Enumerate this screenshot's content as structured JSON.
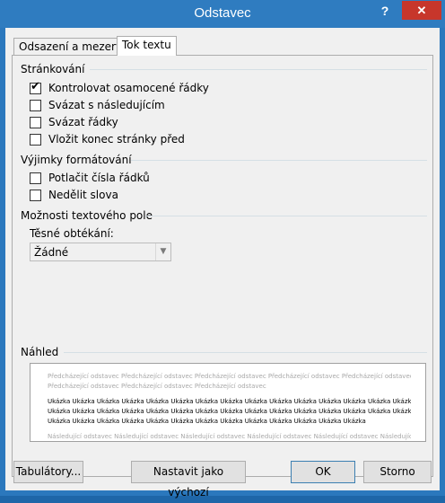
{
  "window": {
    "title": "Odstavec",
    "help": "?",
    "close": "✕"
  },
  "tabs": [
    {
      "label": "Odsazení a mezery"
    },
    {
      "label": "Tok textu"
    }
  ],
  "sections": {
    "pagination": {
      "heading": "Stránkování",
      "items": [
        {
          "label": "Kontrolovat osamocené řádky",
          "checked": true
        },
        {
          "label": "Svázat s následujícím",
          "checked": false
        },
        {
          "label": "Svázat řádky",
          "checked": false
        },
        {
          "label": "Vložit konec stránky před",
          "checked": false
        }
      ]
    },
    "formatting_exceptions": {
      "heading": "Výjimky formátování",
      "items": [
        {
          "label": "Potlačit čísla řádků",
          "checked": false
        },
        {
          "label": "Nedělit slova",
          "checked": false
        }
      ]
    },
    "textbox_options": {
      "heading": "Možnosti textového pole",
      "wrap_label": "Těsné obtékání:",
      "wrap_value": "Žádné"
    },
    "preview": {
      "heading": "Náhled",
      "prev_lines": [
        "Předcházející odstavec Předcházející odstavec Předcházející odstavec Předcházející odstavec Předcházející odstavec",
        "Předcházející odstavec Předcházející odstavec Předcházející odstavec"
      ],
      "sample_lines": [
        "Ukázka Ukázka Ukázka Ukázka Ukázka Ukázka Ukázka Ukázka Ukázka Ukázka Ukázka Ukázka Ukázka Ukázka Ukázka Ukázka",
        "Ukázka Ukázka Ukázka Ukázka Ukázka Ukázka Ukázka Ukázka Ukázka Ukázka Ukázka Ukázka Ukázka Ukázka Ukázka Ukázka",
        "Ukázka Ukázka Ukázka Ukázka Ukázka Ukázka Ukázka Ukázka Ukázka Ukázka Ukázka Ukázka Ukázka"
      ],
      "next_lines": [
        "Následující odstavec Následující odstavec Následující odstavec Následující odstavec Následující odstavec Následující"
      ]
    }
  },
  "buttons": {
    "tabs": "Tabulátory...",
    "set_default": "Nastavit jako výchozí",
    "ok": "OK",
    "cancel": "Storno"
  }
}
